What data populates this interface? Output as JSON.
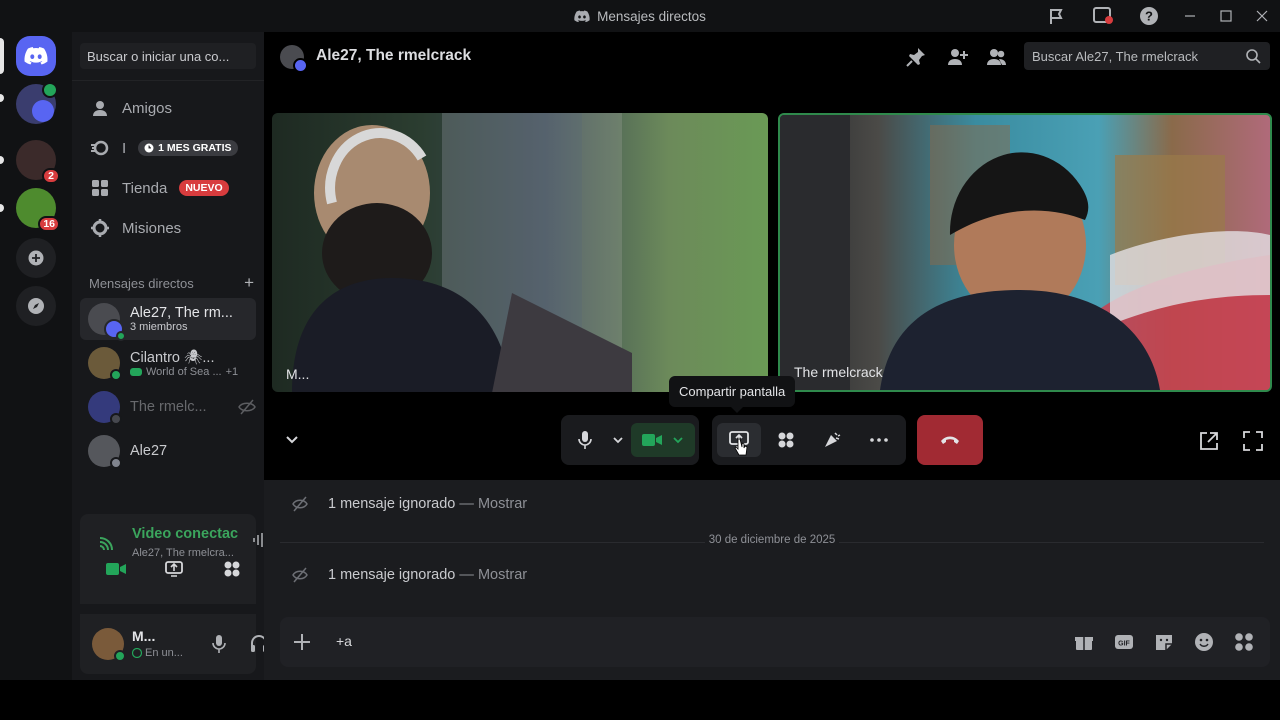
{
  "window": {
    "title": "Mensajes directos"
  },
  "sidebar": {
    "search_placeholder": "Buscar o iniciar una co...",
    "nav": [
      {
        "label": "Amigos"
      },
      {
        "label": "I",
        "tag": "1 MES GRATIS"
      },
      {
        "label": "Tienda",
        "tag": "NUEVO"
      },
      {
        "label": "Misiones"
      }
    ],
    "dm_header": "Mensajes directos",
    "dm_add": "+",
    "dms": [
      {
        "name": "Ale27, The rm...",
        "sub": "3 miembros"
      },
      {
        "name": "Cilantro 🕷...",
        "sub": "World of Sea ...",
        "extra": "+1"
      },
      {
        "name": "The rmelc...",
        "sub": ""
      },
      {
        "name": "Ale27",
        "sub": ""
      }
    ]
  },
  "guilds": {
    "badges": [
      "2",
      "16"
    ]
  },
  "voice": {
    "status": "Video conectac",
    "channel": "Ale27, The rmelcra..."
  },
  "user": {
    "name": "M...",
    "status": "En un..."
  },
  "header": {
    "title": "Ale27, The rmelcrack",
    "search_placeholder": "Buscar Ale27, The rmelcrack"
  },
  "call": {
    "tiles": [
      {
        "label": "M..."
      },
      {
        "label": "The rmelcrack"
      }
    ],
    "tooltip": "Compartir pantalla"
  },
  "chat": {
    "messages": [
      {
        "text": "1 mensaje ignorado",
        "sep": " — ",
        "action": "Mostrar"
      },
      {
        "text": "1 mensaje ignorado",
        "sep": " — ",
        "action": "Mostrar"
      }
    ],
    "date_divider": "30 de diciembre de 2025",
    "composer_text": "+a"
  },
  "colors": {
    "accent": "#5865f2",
    "green": "#23a55a",
    "red": "#da373c",
    "voice_green": "#3ba55d"
  }
}
